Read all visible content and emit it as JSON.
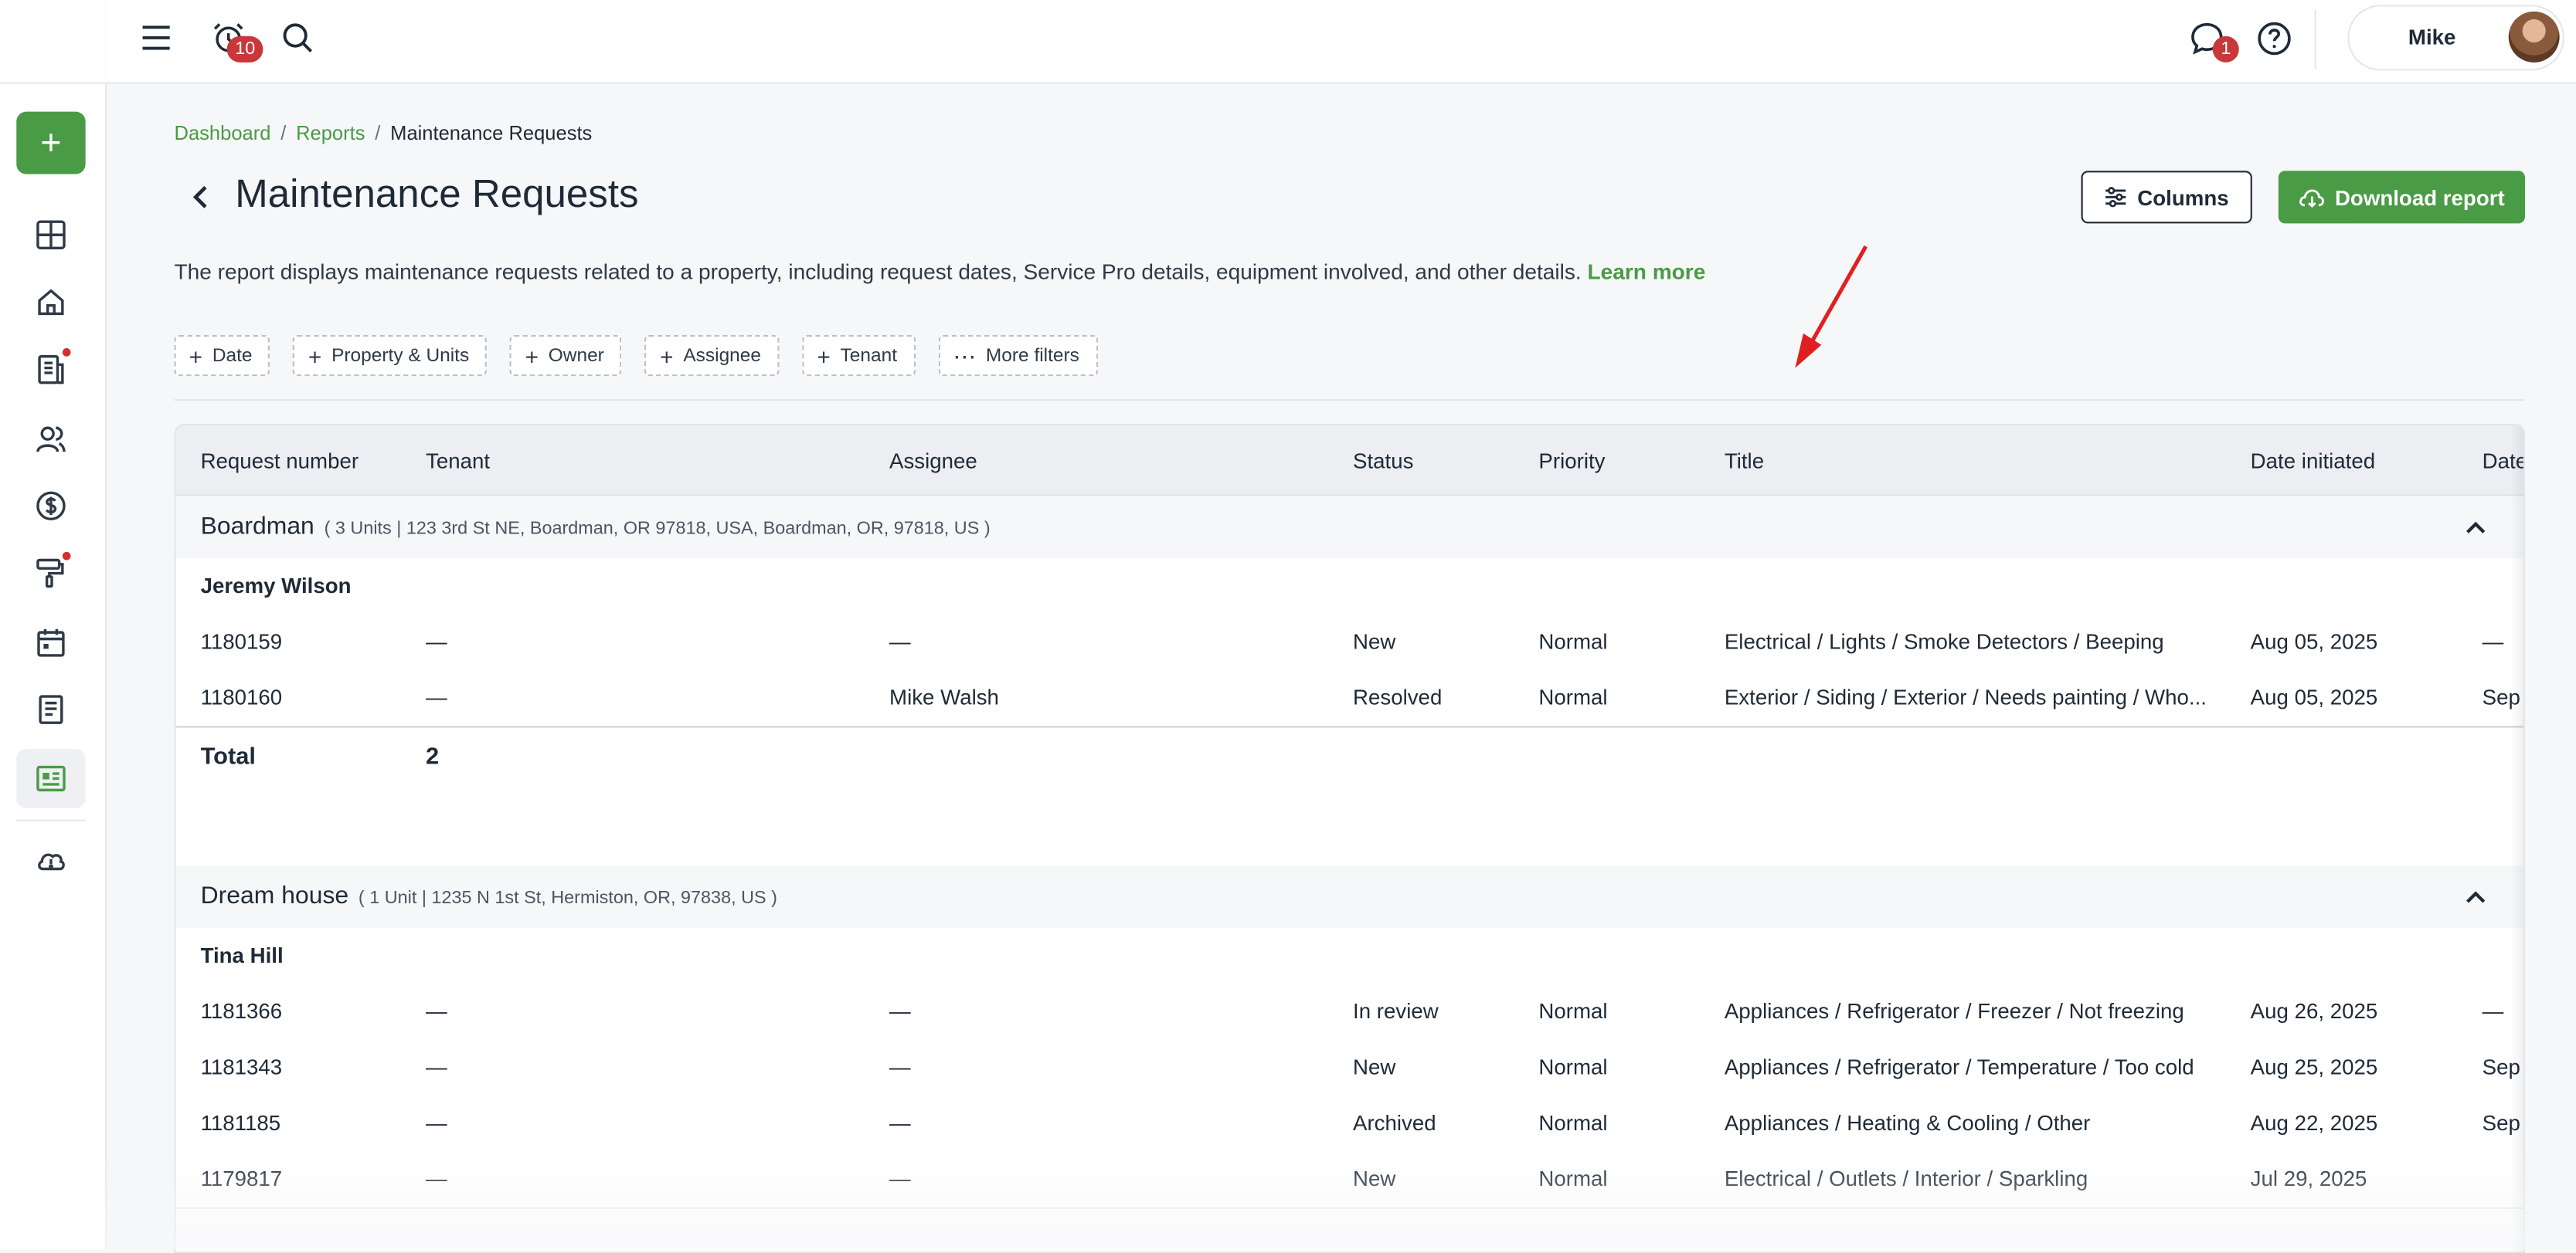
{
  "topbar": {
    "notifications_count": "10",
    "messages_count": "1",
    "user_name": "Mike"
  },
  "breadcrumb": {
    "items": [
      "Dashboard",
      "Reports"
    ],
    "current": "Maintenance Requests",
    "separator": "/"
  },
  "page": {
    "title": "Maintenance Requests",
    "description": "The report displays maintenance requests related to a property, including request dates, Service Pro details, equipment involved, and other details.",
    "learn_more": "Learn more",
    "columns_button": "Columns",
    "download_button": "Download report"
  },
  "filters": [
    "Date",
    "Property & Units",
    "Owner",
    "Assignee",
    "Tenant"
  ],
  "more_filters": "More filters",
  "table": {
    "headers": [
      "Request number",
      "Tenant",
      "Assignee",
      "Status",
      "Priority",
      "Title",
      "Date initiated",
      "Date"
    ],
    "groups": [
      {
        "name": "Boardman",
        "address": "( 3 Units | 123 3rd St NE, Boardman, OR 97818, USA, Boardman, OR, 97818, US )",
        "person": "Jeremy Wilson",
        "rows": [
          [
            "1180159",
            "—",
            "—",
            "New",
            "Normal",
            "Electrical / Lights / Smoke Detectors / Beeping",
            "Aug 05, 2025",
            "—"
          ],
          [
            "1180160",
            "—",
            "Mike Walsh",
            "Resolved",
            "Normal",
            "Exterior / Siding / Exterior / Needs painting / Who...",
            "Aug 05, 2025",
            "Sep"
          ]
        ],
        "total_label": "Total",
        "total_value": "2"
      },
      {
        "name": "Dream house",
        "address": "( 1 Unit | 1235 N 1st St, Hermiston, OR, 97838, US )",
        "person": "Tina Hill",
        "rows": [
          [
            "1181366",
            "—",
            "—",
            "In review",
            "Normal",
            "Appliances / Refrigerator / Freezer / Not freezing",
            "Aug 26, 2025",
            "—"
          ],
          [
            "1181343",
            "—",
            "—",
            "New",
            "Normal",
            "Appliances / Refrigerator / Temperature / Too cold",
            "Aug 25, 2025",
            "Sep"
          ],
          [
            "1181185",
            "—",
            "—",
            "Archived",
            "Normal",
            "Appliances / Heating & Cooling / Other",
            "Aug 22, 2025",
            "Sep"
          ],
          [
            "1179817",
            "—",
            "—",
            "New",
            "Normal",
            "Electrical / Outlets / Interior / Sparkling",
            "Jul 29, 2025",
            ""
          ]
        ]
      }
    ]
  },
  "colors": {
    "brand_green": "#4a9b45",
    "badge_red": "#c8373a",
    "annotation_arrow": "#e02020"
  },
  "icons": {
    "sidebar": [
      "plus-icon",
      "dashboard-icon",
      "home-icon",
      "building-doc-icon",
      "people-icon",
      "dollar-icon",
      "paint-roller-icon",
      "calendar-icon",
      "document-icon",
      "reports-icon",
      "cloud-icon"
    ],
    "topbar": [
      "menu-icon",
      "alarm-clock-icon",
      "search-icon",
      "chat-icon",
      "help-icon"
    ]
  }
}
